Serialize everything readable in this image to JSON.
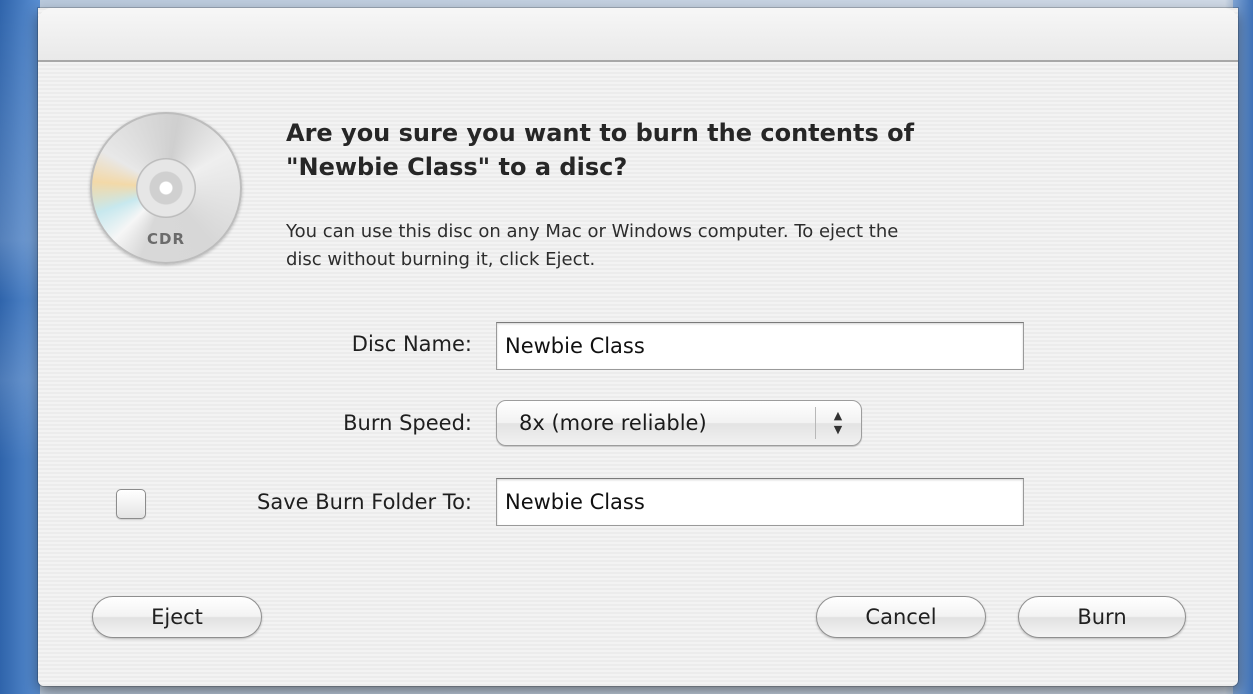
{
  "dialog": {
    "icon": {
      "name": "cdr-disc-icon",
      "label": "CDR"
    },
    "heading_line1": "Are you sure you want to burn the contents of",
    "heading_line2": "\"Newbie Class\" to a disc?",
    "info_line1": "You can use this disc on any Mac or Windows computer. To eject the",
    "info_line2": "disc without burning it, click Eject."
  },
  "form": {
    "disc_name_label": "Disc Name:",
    "disc_name_value": "Newbie Class",
    "burn_speed_label": "Burn Speed:",
    "burn_speed_value": "8x (more reliable)",
    "save_folder_label": "Save Burn Folder To:",
    "save_folder_checked": false,
    "save_folder_value": "Newbie Class"
  },
  "buttons": {
    "eject": "Eject",
    "cancel": "Cancel",
    "burn": "Burn"
  },
  "colors": {
    "desktop_blue": "#3b6fb3",
    "dialog_bg": "#ececec"
  }
}
